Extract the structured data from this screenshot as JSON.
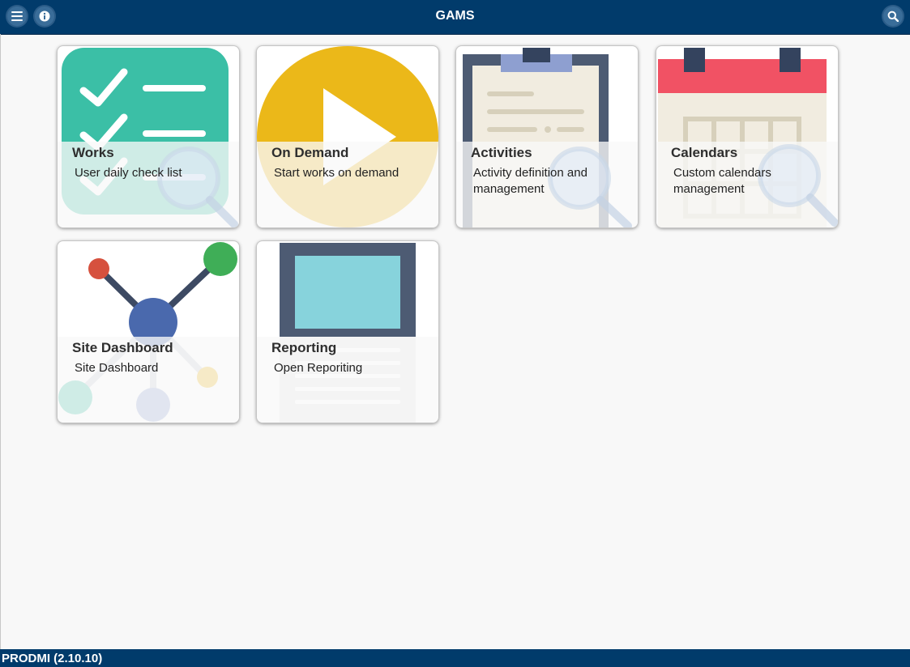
{
  "header": {
    "title": "GAMS"
  },
  "icons": {
    "menu": "menu-icon",
    "info": "info-icon",
    "search": "search-icon"
  },
  "tiles": [
    {
      "title": "Works",
      "subtitle": "User daily check list",
      "icon": "checklist-icon"
    },
    {
      "title": "On Demand",
      "subtitle": "Start works on demand",
      "icon": "play-icon"
    },
    {
      "title": "Activities",
      "subtitle": "Activity definition and management",
      "icon": "clipboard-icon"
    },
    {
      "title": "Calendars",
      "subtitle": "Custom calendars management",
      "icon": "calendar-icon"
    },
    {
      "title": "Site Dashboard",
      "subtitle": "Site Dashboard",
      "icon": "network-icon"
    },
    {
      "title": "Reporting",
      "subtitle": "Open Reporiting",
      "icon": "monitor-icon"
    }
  ],
  "footer": {
    "version": "PRODMI (2.10.10)"
  },
  "colors": {
    "header_bg": "#013b6b",
    "teal": "#3bbfa6",
    "yellow": "#ebb819",
    "red": "#f15264",
    "navy": "#4d5b73"
  }
}
